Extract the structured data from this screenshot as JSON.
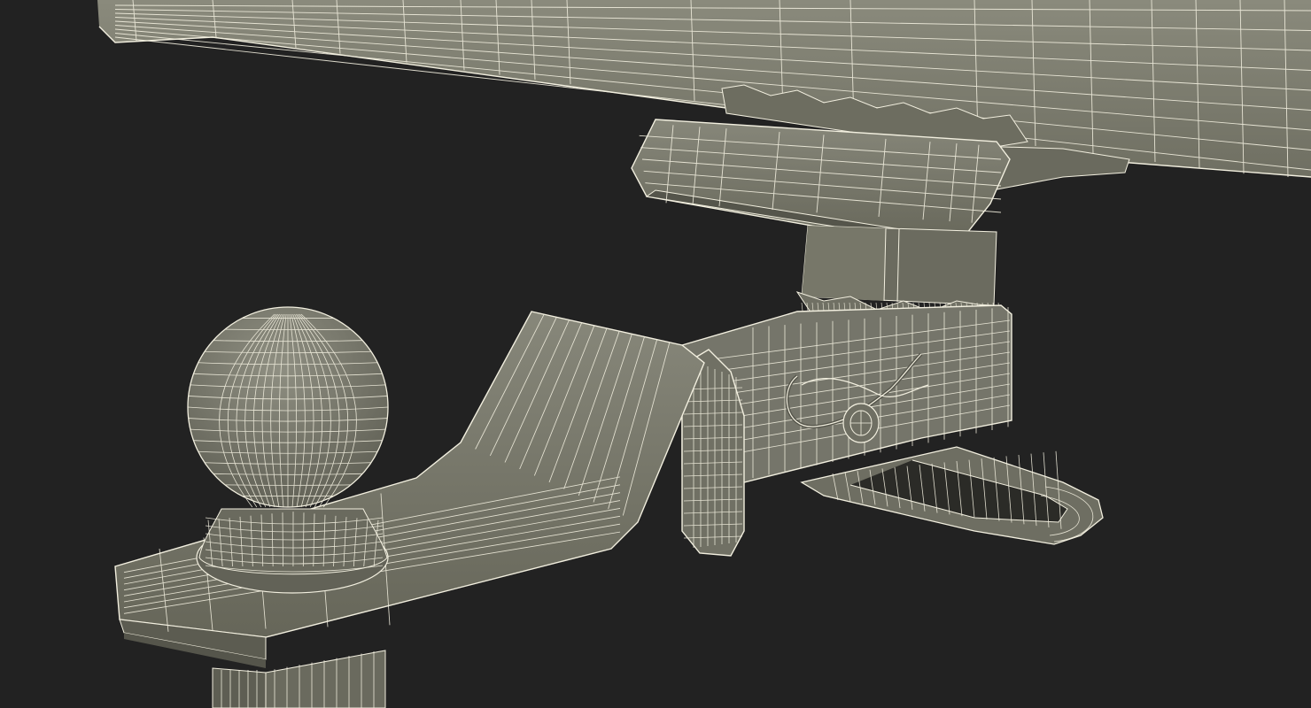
{
  "scene": {
    "background_color": "#222222",
    "surface_color": "#777768",
    "surface_shade_color": "#5f5f54",
    "surface_light_color": "#8a8a7c",
    "wire_color": "#f2efdf",
    "objects": [
      "receiver-tube",
      "receiver-bracket",
      "hitch-shank",
      "ball-mount",
      "tow-ball",
      "hitch-pin",
      "hitch-pin-clip"
    ]
  }
}
